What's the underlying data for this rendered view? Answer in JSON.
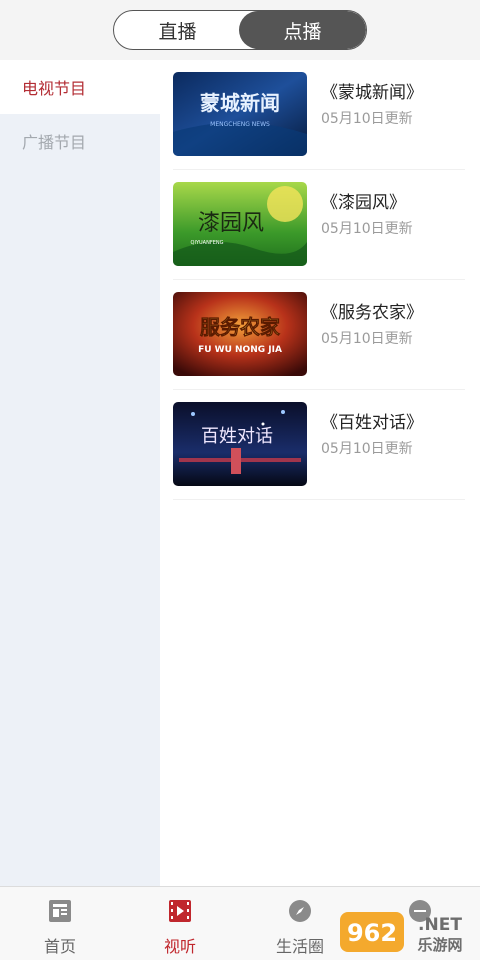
{
  "mode_switch": {
    "live_label": "直播",
    "vod_label": "点播",
    "selected": "点播"
  },
  "sidebar": {
    "items": [
      {
        "label": "电视节目",
        "active": true
      },
      {
        "label": "广播节目",
        "active": false
      }
    ]
  },
  "programs": [
    {
      "title": "《蒙城新闻》",
      "updated": "05月10日更新",
      "thumb_text": "蒙城新闻",
      "thumb_sub": "MENGCHENG NEWS"
    },
    {
      "title": "《漆园风》",
      "updated": "05月10日更新",
      "thumb_text": "漆园风",
      "thumb_sub": "QIYUANFENG"
    },
    {
      "title": "《服务农家》",
      "updated": "05月10日更新",
      "thumb_text": "服务农家",
      "thumb_sub": "FU WU NONG JIA"
    },
    {
      "title": "《百姓对话》",
      "updated": "05月10日更新",
      "thumb_text": "百姓对话",
      "thumb_sub": ""
    }
  ],
  "tabbar": {
    "items": [
      {
        "label": "首页",
        "icon": "news-icon",
        "active": false
      },
      {
        "label": "视听",
        "icon": "video-icon",
        "active": true
      },
      {
        "label": "生活圈",
        "icon": "compass-icon",
        "active": false
      },
      {
        "label": "",
        "icon": "user-icon",
        "active": false
      }
    ]
  },
  "watermark": {
    "text": "962.NET",
    "sub": "乐游网"
  },
  "colors": {
    "accent": "#c0272d",
    "sidebar_bg": "#edf1f7",
    "segment_active": "#555555"
  }
}
